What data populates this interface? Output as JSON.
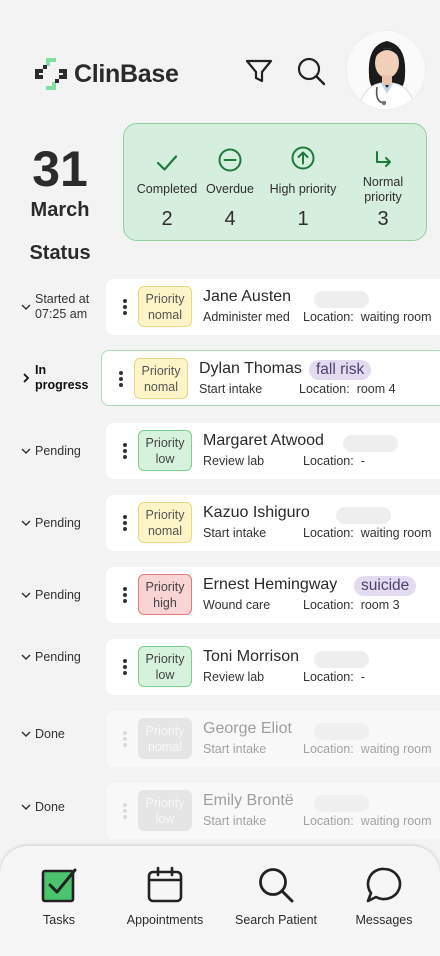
{
  "app": {
    "name": "ClinBase"
  },
  "date": {
    "day": "31",
    "month": "March"
  },
  "status_heading": "Status",
  "summary": [
    {
      "icon": "check-icon",
      "label": "Completed",
      "count": "2"
    },
    {
      "icon": "minus-circle-icon",
      "label": "Overdue",
      "count": "4"
    },
    {
      "icon": "arrow-up-circle-icon",
      "label": "High priority",
      "count": "1"
    },
    {
      "icon": "arrow-turn-down-right-icon",
      "label": "Normal priority",
      "count": "3"
    }
  ],
  "labels": {
    "location_prefix": "Location:"
  },
  "tasks": [
    {
      "status": "Started at 07:25 am",
      "priority_word": "Priority",
      "priority": "nomal",
      "level": "normal",
      "name": "Jane Austen",
      "task": "Administer med",
      "location": "waiting room",
      "tag": ""
    },
    {
      "status": "In progress",
      "priority_word": "Priority",
      "priority": "nomal",
      "level": "normal",
      "name": "Dylan Thomas",
      "task": "Start intake",
      "location": "room 4",
      "tag": "fall risk"
    },
    {
      "status": "Pending",
      "priority_word": "Priority",
      "priority": "low",
      "level": "low",
      "name": "Margaret Atwood",
      "task": "Review lab",
      "location": "-",
      "tag": ""
    },
    {
      "status": "Pending",
      "priority_word": "Priority",
      "priority": "nomal",
      "level": "normal",
      "name": "Kazuo Ishiguro",
      "task": "Start intake",
      "location": "waiting room",
      "tag": ""
    },
    {
      "status": "Pending",
      "priority_word": "Priority",
      "priority": "high",
      "level": "high",
      "name": "Ernest Hemingway",
      "task": "Wound care",
      "location": "room 3",
      "tag": "suicide"
    },
    {
      "status": "Pending",
      "priority_word": "Priority",
      "priority": "low",
      "level": "low",
      "name": "Toni Morrison",
      "task": "Review lab",
      "location": "-",
      "tag": ""
    },
    {
      "status": "Done",
      "priority_word": "Priority",
      "priority": "nomal",
      "level": "normal",
      "name": "George Eliot",
      "task": "Start intake",
      "location": "waiting room",
      "tag": ""
    },
    {
      "status": "Done",
      "priority_word": "Priority",
      "priority": "low",
      "level": "low",
      "name": "Emily Brontë",
      "task": "Start intake",
      "location": "waiting room",
      "tag": ""
    }
  ],
  "nav": [
    {
      "icon": "tasks-check-icon",
      "label": "Tasks"
    },
    {
      "icon": "calendar-icon",
      "label": "Appointments"
    },
    {
      "icon": "search-icon",
      "label": "Search Patient"
    },
    {
      "icon": "chat-bubble-icon",
      "label": "Messages"
    }
  ],
  "colors": {
    "accent": "#1d7a3c",
    "summary_bg": "#d6eedd",
    "tag_bg": "#e3dcf0"
  }
}
